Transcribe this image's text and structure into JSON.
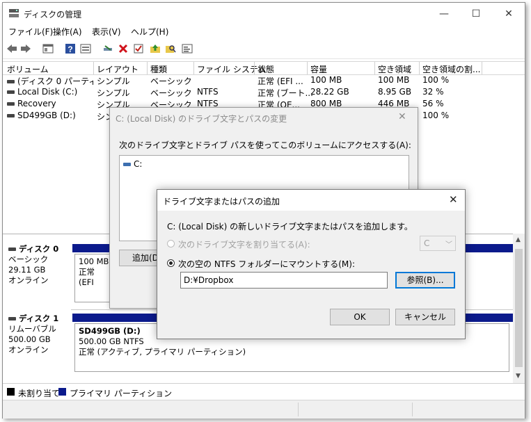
{
  "window": {
    "title": "ディスクの管理",
    "minimize": "—",
    "maximize": "☐",
    "close": "✕"
  },
  "menu": [
    "ファイル(F)",
    "操作(A)",
    "表示(V)",
    "ヘルプ(H)"
  ],
  "table": {
    "headers": [
      "ボリューム",
      "レイアウト",
      "種類",
      "ファイル システム",
      "状態",
      "容量",
      "空き領域",
      "空き領域の割..."
    ],
    "rows": [
      [
        "(ディスク 0 パーティシ...",
        "シンプル",
        "ベーシック",
        "",
        "正常 (EFI ...",
        "100 MB",
        "100 MB",
        "100 %"
      ],
      [
        "Local Disk (C:)",
        "シンプル",
        "ベーシック",
        "NTFS",
        "正常 (ブート...",
        "28.22 GB",
        "8.95 GB",
        "32 %"
      ],
      [
        "Recovery",
        "シンプル",
        "ベーシック",
        "NTFS",
        "正常 (OE...",
        "800 MB",
        "446 MB",
        "56 %"
      ],
      [
        "SD499GB (D:)",
        "シン",
        "",
        "",
        "",
        "",
        "",
        "100 %"
      ]
    ]
  },
  "disks": {
    "disk0": {
      "name": "ディスク 0",
      "type": "ベーシック",
      "size": "29.11 GB",
      "status": "オンライン",
      "partition_size": "100 MB",
      "partition_status": "正常 (EFI"
    },
    "disk1": {
      "name": "ディスク 1",
      "type": "リムーバブル",
      "size": "500.00 GB",
      "status": "オンライン",
      "partition_name": "SD499GB  (D:)",
      "partition_size": "500.00 GB NTFS",
      "partition_status": "正常 (アクティブ, プライマリ パーティション)"
    }
  },
  "legend": {
    "unallocated": "未割り当て",
    "primary": "プライマリ パーティション"
  },
  "dialog_change": {
    "title": "C: (Local Disk) のドライブ文字とパスの変更",
    "instruction": "次のドライブ文字とドライブ パスを使ってこのボリュームにアクセスする(A):",
    "list_item": "C:",
    "add_button": "追加(D"
  },
  "dialog_add": {
    "title": "ドライブ文字またはパスの追加",
    "description": "C: (Local Disk) の新しいドライブ文字またはパスを追加します。",
    "option_letter": "次のドライブ文字を割り当てる(A):",
    "letter_value": "C",
    "option_folder": "次の空の NTFS フォルダーにマウントする(M):",
    "folder_value": "D:¥Dropbox",
    "browse_button": "参照(B)...",
    "ok_button": "OK",
    "cancel_button": "キャンセル"
  },
  "colors": {
    "primary_partition": "#0b1a8c",
    "unallocated": "#000000"
  }
}
